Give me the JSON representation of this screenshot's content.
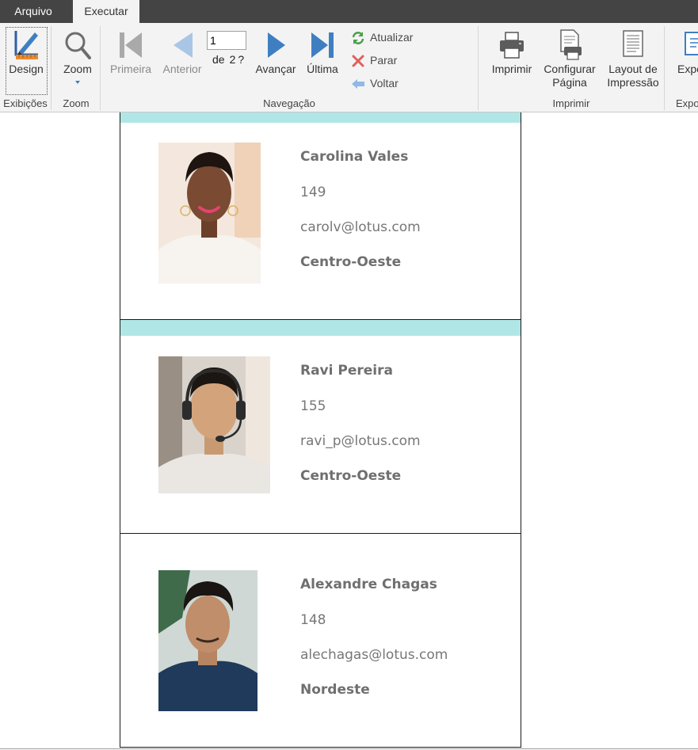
{
  "tabs": {
    "file": "Arquivo",
    "run": "Executar"
  },
  "ribbon": {
    "views": {
      "design": "Design",
      "group": "Exibições"
    },
    "zoom": {
      "label": "Zoom",
      "group": "Zoom"
    },
    "navigation": {
      "first": "Primeira",
      "previous": "Anterior",
      "page_value": "1",
      "of_label": "de",
      "total_pages": "2",
      "unknown_mark": "?",
      "next": "Avançar",
      "last": "Última",
      "refresh": "Atualizar",
      "stop": "Parar",
      "back": "Voltar",
      "group": "Navegação"
    },
    "print": {
      "print": "Imprimir",
      "page_setup_line1": "Configurar",
      "page_setup_line2": "Página",
      "print_layout_line1": "Layout de",
      "print_layout_line2": "Impressão",
      "group": "Imprimir"
    },
    "export": {
      "label": "Expo",
      "group": "Expo"
    }
  },
  "records": [
    {
      "name": "Carolina Vales",
      "ext": "149",
      "email": "carolv@lotus.com",
      "region": "Centro-Oeste"
    },
    {
      "name": "Ravi Pereira",
      "ext": "155",
      "email": "ravi_p@lotus.com",
      "region": "Centro-Oeste"
    },
    {
      "name": "Alexandre Chagas",
      "ext": "148",
      "email": "alechagas@lotus.com",
      "region": "Nordeste"
    }
  ],
  "colors": {
    "band": "#b1e6e6",
    "ribbon": "#f3f3f3",
    "titlebar": "#444444",
    "nav_blue": "#3f7fc1"
  }
}
